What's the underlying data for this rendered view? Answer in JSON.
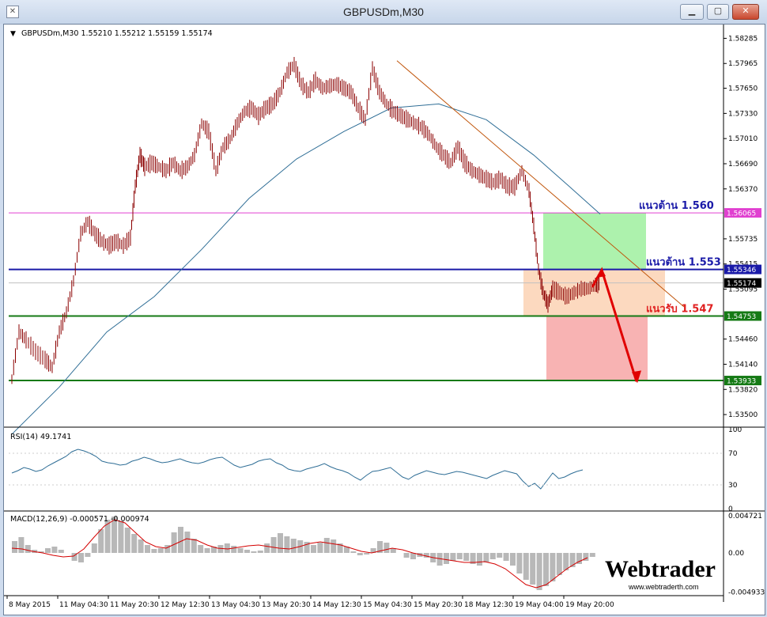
{
  "window": {
    "title": "GBPUSDm,M30",
    "buttons": {
      "minimize": "▁",
      "restore": "▢",
      "close": "✕"
    }
  },
  "colors": {
    "background": "#ffffff",
    "candle": "#8b0000",
    "ma_line": "#2f6e96",
    "trend_line": "#c0540a",
    "resistance_upper": "#e040d0",
    "resistance_lower": "#1a1aa8",
    "support": "#157a15",
    "arrow": "#e00000",
    "price_box": "#000000",
    "green_zone": "#9ff09f",
    "orange_zone": "#fcd2b4",
    "red_zone": "#f7a6a6",
    "rsi_line": "#2f6e96",
    "macd_hist": "#b8b8b8",
    "macd_signal": "#d40000"
  },
  "chart_data": [
    {
      "type": "candlestick",
      "symbol": "GBPUSDm",
      "timeframe": "M30",
      "header": "GBPUSDm,M30  1.55210 1.55212 1.55159 1.55174",
      "ohlc_last": {
        "open": 1.5521,
        "high": 1.55212,
        "low": 1.55159,
        "close": 1.55174
      },
      "ylim": [
        1.5335,
        1.584
      ],
      "y_ticks": [
        "1.58285",
        "1.57965",
        "1.57650",
        "1.57330",
        "1.57010",
        "1.56690",
        "1.56370",
        "1.55735",
        "1.55415",
        "1.55095",
        "1.54460",
        "1.54140",
        "1.53820",
        "1.53500"
      ],
      "x_ticks": [
        "8 May 2015",
        "11 May 04:30",
        "11 May 20:30",
        "12 May 12:30",
        "13 May 04:30",
        "13 May 20:30",
        "14 May 12:30",
        "15 May 04:30",
        "15 May 20:30",
        "18 May 12:30",
        "19 May 04:00",
        "19 May 20:00"
      ],
      "close_path": [
        [
          0,
          1.5395
        ],
        [
          6,
          1.5455
        ],
        [
          12,
          1.5445
        ],
        [
          20,
          1.543
        ],
        [
          28,
          1.542
        ],
        [
          34,
          1.541
        ],
        [
          40,
          1.5455
        ],
        [
          46,
          1.548
        ],
        [
          52,
          1.552
        ],
        [
          58,
          1.558
        ],
        [
          64,
          1.5595
        ],
        [
          70,
          1.558
        ],
        [
          76,
          1.557
        ],
        [
          82,
          1.5565
        ],
        [
          88,
          1.557
        ],
        [
          94,
          1.5565
        ],
        [
          100,
          1.5575
        ],
        [
          104,
          1.564
        ],
        [
          108,
          1.568
        ],
        [
          112,
          1.5665
        ],
        [
          118,
          1.567
        ],
        [
          124,
          1.5665
        ],
        [
          130,
          1.566
        ],
        [
          136,
          1.567
        ],
        [
          142,
          1.566
        ],
        [
          148,
          1.5665
        ],
        [
          154,
          1.568
        ],
        [
          160,
          1.572
        ],
        [
          166,
          1.571
        ],
        [
          172,
          1.566
        ],
        [
          178,
          1.569
        ],
        [
          184,
          1.57
        ],
        [
          190,
          1.572
        ],
        [
          196,
          1.5735
        ],
        [
          202,
          1.574
        ],
        [
          208,
          1.573
        ],
        [
          214,
          1.574
        ],
        [
          220,
          1.5745
        ],
        [
          226,
          1.576
        ],
        [
          232,
          1.5785
        ],
        [
          238,
          1.5795
        ],
        [
          244,
          1.577
        ],
        [
          250,
          1.576
        ],
        [
          256,
          1.5775
        ],
        [
          262,
          1.5765
        ],
        [
          268,
          1.5768
        ],
        [
          274,
          1.577
        ],
        [
          280,
          1.5765
        ],
        [
          286,
          1.576
        ],
        [
          292,
          1.574
        ],
        [
          298,
          1.5725
        ],
        [
          304,
          1.579
        ],
        [
          310,
          1.576
        ],
        [
          316,
          1.5745
        ],
        [
          322,
          1.5735
        ],
        [
          328,
          1.573
        ],
        [
          334,
          1.5725
        ],
        [
          340,
          1.572
        ],
        [
          346,
          1.5715
        ],
        [
          352,
          1.5705
        ],
        [
          358,
          1.569
        ],
        [
          364,
          1.568
        ],
        [
          370,
          1.567
        ],
        [
          376,
          1.569
        ],
        [
          382,
          1.567
        ],
        [
          388,
          1.566
        ],
        [
          394,
          1.5655
        ],
        [
          400,
          1.565
        ],
        [
          406,
          1.5645
        ],
        [
          412,
          1.565
        ],
        [
          418,
          1.564
        ],
        [
          424,
          1.564
        ],
        [
          430,
          1.566
        ],
        [
          436,
          1.5635
        ],
        [
          440,
          1.559
        ],
        [
          444,
          1.5535
        ],
        [
          448,
          1.5505
        ],
        [
          452,
          1.549
        ],
        [
          456,
          1.551
        ],
        [
          462,
          1.5505
        ],
        [
          468,
          1.55
        ],
        [
          474,
          1.5505
        ],
        [
          480,
          1.551
        ],
        [
          486,
          1.551
        ],
        [
          492,
          1.5515
        ],
        [
          496,
          1.5517
        ]
      ],
      "moving_average": [
        [
          0,
          1.5325
        ],
        [
          40,
          1.5385
        ],
        [
          80,
          1.5455
        ],
        [
          120,
          1.55
        ],
        [
          160,
          1.556
        ],
        [
          200,
          1.5625
        ],
        [
          240,
          1.5675
        ],
        [
          280,
          1.571
        ],
        [
          320,
          1.574
        ],
        [
          360,
          1.5745
        ],
        [
          400,
          1.5725
        ],
        [
          440,
          1.568
        ],
        [
          470,
          1.564
        ],
        [
          496,
          1.5605
        ]
      ],
      "trend_line": {
        "from": [
          "15 May 04:30",
          1.58
        ],
        "to": [
          "19 May 20:00",
          1.5487
        ]
      },
      "levels": [
        {
          "price": 1.56065,
          "label": "1.56065",
          "annotation": "แนวต้าน 1.560",
          "color": "#e040d0"
        },
        {
          "price": 1.55346,
          "label": "1.55346",
          "annotation": "แนวต้าน 1.553",
          "color": "#1a1aa8"
        },
        {
          "price": 1.55174,
          "label": "1.55174",
          "annotation": "",
          "color": "#000000"
        },
        {
          "price": 1.54753,
          "label": "1.54753",
          "annotation": "แนวรับ 1.547",
          "color": "#157a15"
        },
        {
          "price": 1.53933,
          "label": "1.53933",
          "annotation": "",
          "color": "#157a15"
        }
      ],
      "zones": [
        {
          "name": "green",
          "from": 1.56065,
          "to": 1.55346
        },
        {
          "name": "orange",
          "from": 1.55346,
          "to": 1.54753
        },
        {
          "name": "red",
          "from": 1.54753,
          "to": 1.53933
        }
      ],
      "forecast_arrow": [
        [
          1.5512
        ],
        [
          1.5534
        ],
        [
          1.5392
        ]
      ]
    },
    {
      "type": "line",
      "name": "RSI(14) 49.1741",
      "ylim": [
        0,
        100
      ],
      "y_ticks": [
        "100",
        "70",
        "30",
        "0"
      ],
      "values": [
        45,
        48,
        52,
        50,
        47,
        49,
        54,
        58,
        62,
        66,
        72,
        75,
        73,
        70,
        66,
        60,
        58,
        57,
        55,
        56,
        60,
        62,
        65,
        63,
        60,
        58,
        59,
        61,
        63,
        60,
        58,
        57,
        59,
        62,
        64,
        65,
        60,
        55,
        52,
        54,
        56,
        60,
        62,
        63,
        58,
        55,
        50,
        48,
        47,
        50,
        52,
        54,
        57,
        53,
        50,
        48,
        45,
        40,
        36,
        42,
        47,
        48,
        50,
        52,
        46,
        40,
        37,
        42,
        45,
        48,
        46,
        44,
        43,
        45,
        47,
        46,
        44,
        42,
        40,
        38,
        42,
        45,
        48,
        46,
        44,
        35,
        28,
        32,
        25,
        35,
        45,
        38,
        40,
        44,
        47,
        49
      ]
    },
    {
      "type": "bar",
      "name": "MACD(12,26,9) -0.000571 -0.000974",
      "ylim": [
        -0.005,
        0.005
      ],
      "y_ticks": [
        "0.004721",
        "0.00",
        "-0.004933"
      ],
      "histogram": [
        0.0015,
        0.002,
        0.001,
        0.0004,
        0.0002,
        0.0006,
        0.0008,
        0.0004,
        0.0,
        -0.001,
        -0.0012,
        -0.0005,
        0.0012,
        0.003,
        0.0042,
        0.0046,
        0.004,
        0.0032,
        0.0024,
        0.0017,
        0.001,
        0.0005,
        0.0006,
        0.001,
        0.0026,
        0.0033,
        0.0027,
        0.0018,
        0.001,
        0.0006,
        0.0008,
        0.001,
        0.0012,
        0.0009,
        0.0006,
        0.0004,
        0.0002,
        0.0003,
        0.0012,
        0.002,
        0.0025,
        0.0021,
        0.0018,
        0.0016,
        0.0014,
        0.001,
        0.0013,
        0.0019,
        0.0017,
        0.0012,
        0.0008,
        0.0002,
        -0.0003,
        -0.0002,
        0.0006,
        0.0015,
        0.0013,
        0.0006,
        0.0,
        -0.0006,
        -0.0008,
        -0.0005,
        -0.0006,
        -0.0012,
        -0.0016,
        -0.0014,
        -0.001,
        -0.0008,
        -0.001,
        -0.0014,
        -0.0016,
        -0.0012,
        -0.0008,
        -0.0006,
        -0.001,
        -0.0016,
        -0.0026,
        -0.0034,
        -0.004,
        -0.0047,
        -0.0042,
        -0.0036,
        -0.0028,
        -0.0022,
        -0.0018,
        -0.0014,
        -0.001,
        -0.0005
      ],
      "signal": [
        0.0006,
        0.0005,
        0.0002,
        0.0,
        -0.0003,
        -0.0005,
        -0.0004,
        0.0005,
        0.002,
        0.0034,
        0.0042,
        0.0038,
        0.0026,
        0.0014,
        0.0008,
        0.0006,
        0.0012,
        0.0018,
        0.0016,
        0.001,
        0.0006,
        0.0005,
        0.0007,
        0.0009,
        0.001,
        0.0008,
        0.0006,
        0.0005,
        0.0008,
        0.0012,
        0.0014,
        0.0012,
        0.001,
        0.0006,
        0.0002,
        0.0,
        0.0003,
        0.0006,
        0.0004,
        0.0,
        -0.0003,
        -0.0006,
        -0.0008,
        -0.001,
        -0.0012,
        -0.0012,
        -0.0011,
        -0.0014,
        -0.002,
        -0.003,
        -0.004,
        -0.0044,
        -0.004,
        -0.003,
        -0.002,
        -0.0012,
        -0.0006
      ]
    }
  ],
  "logo": {
    "brand": "Webtrader",
    "url": "www.webtraderth.com"
  }
}
